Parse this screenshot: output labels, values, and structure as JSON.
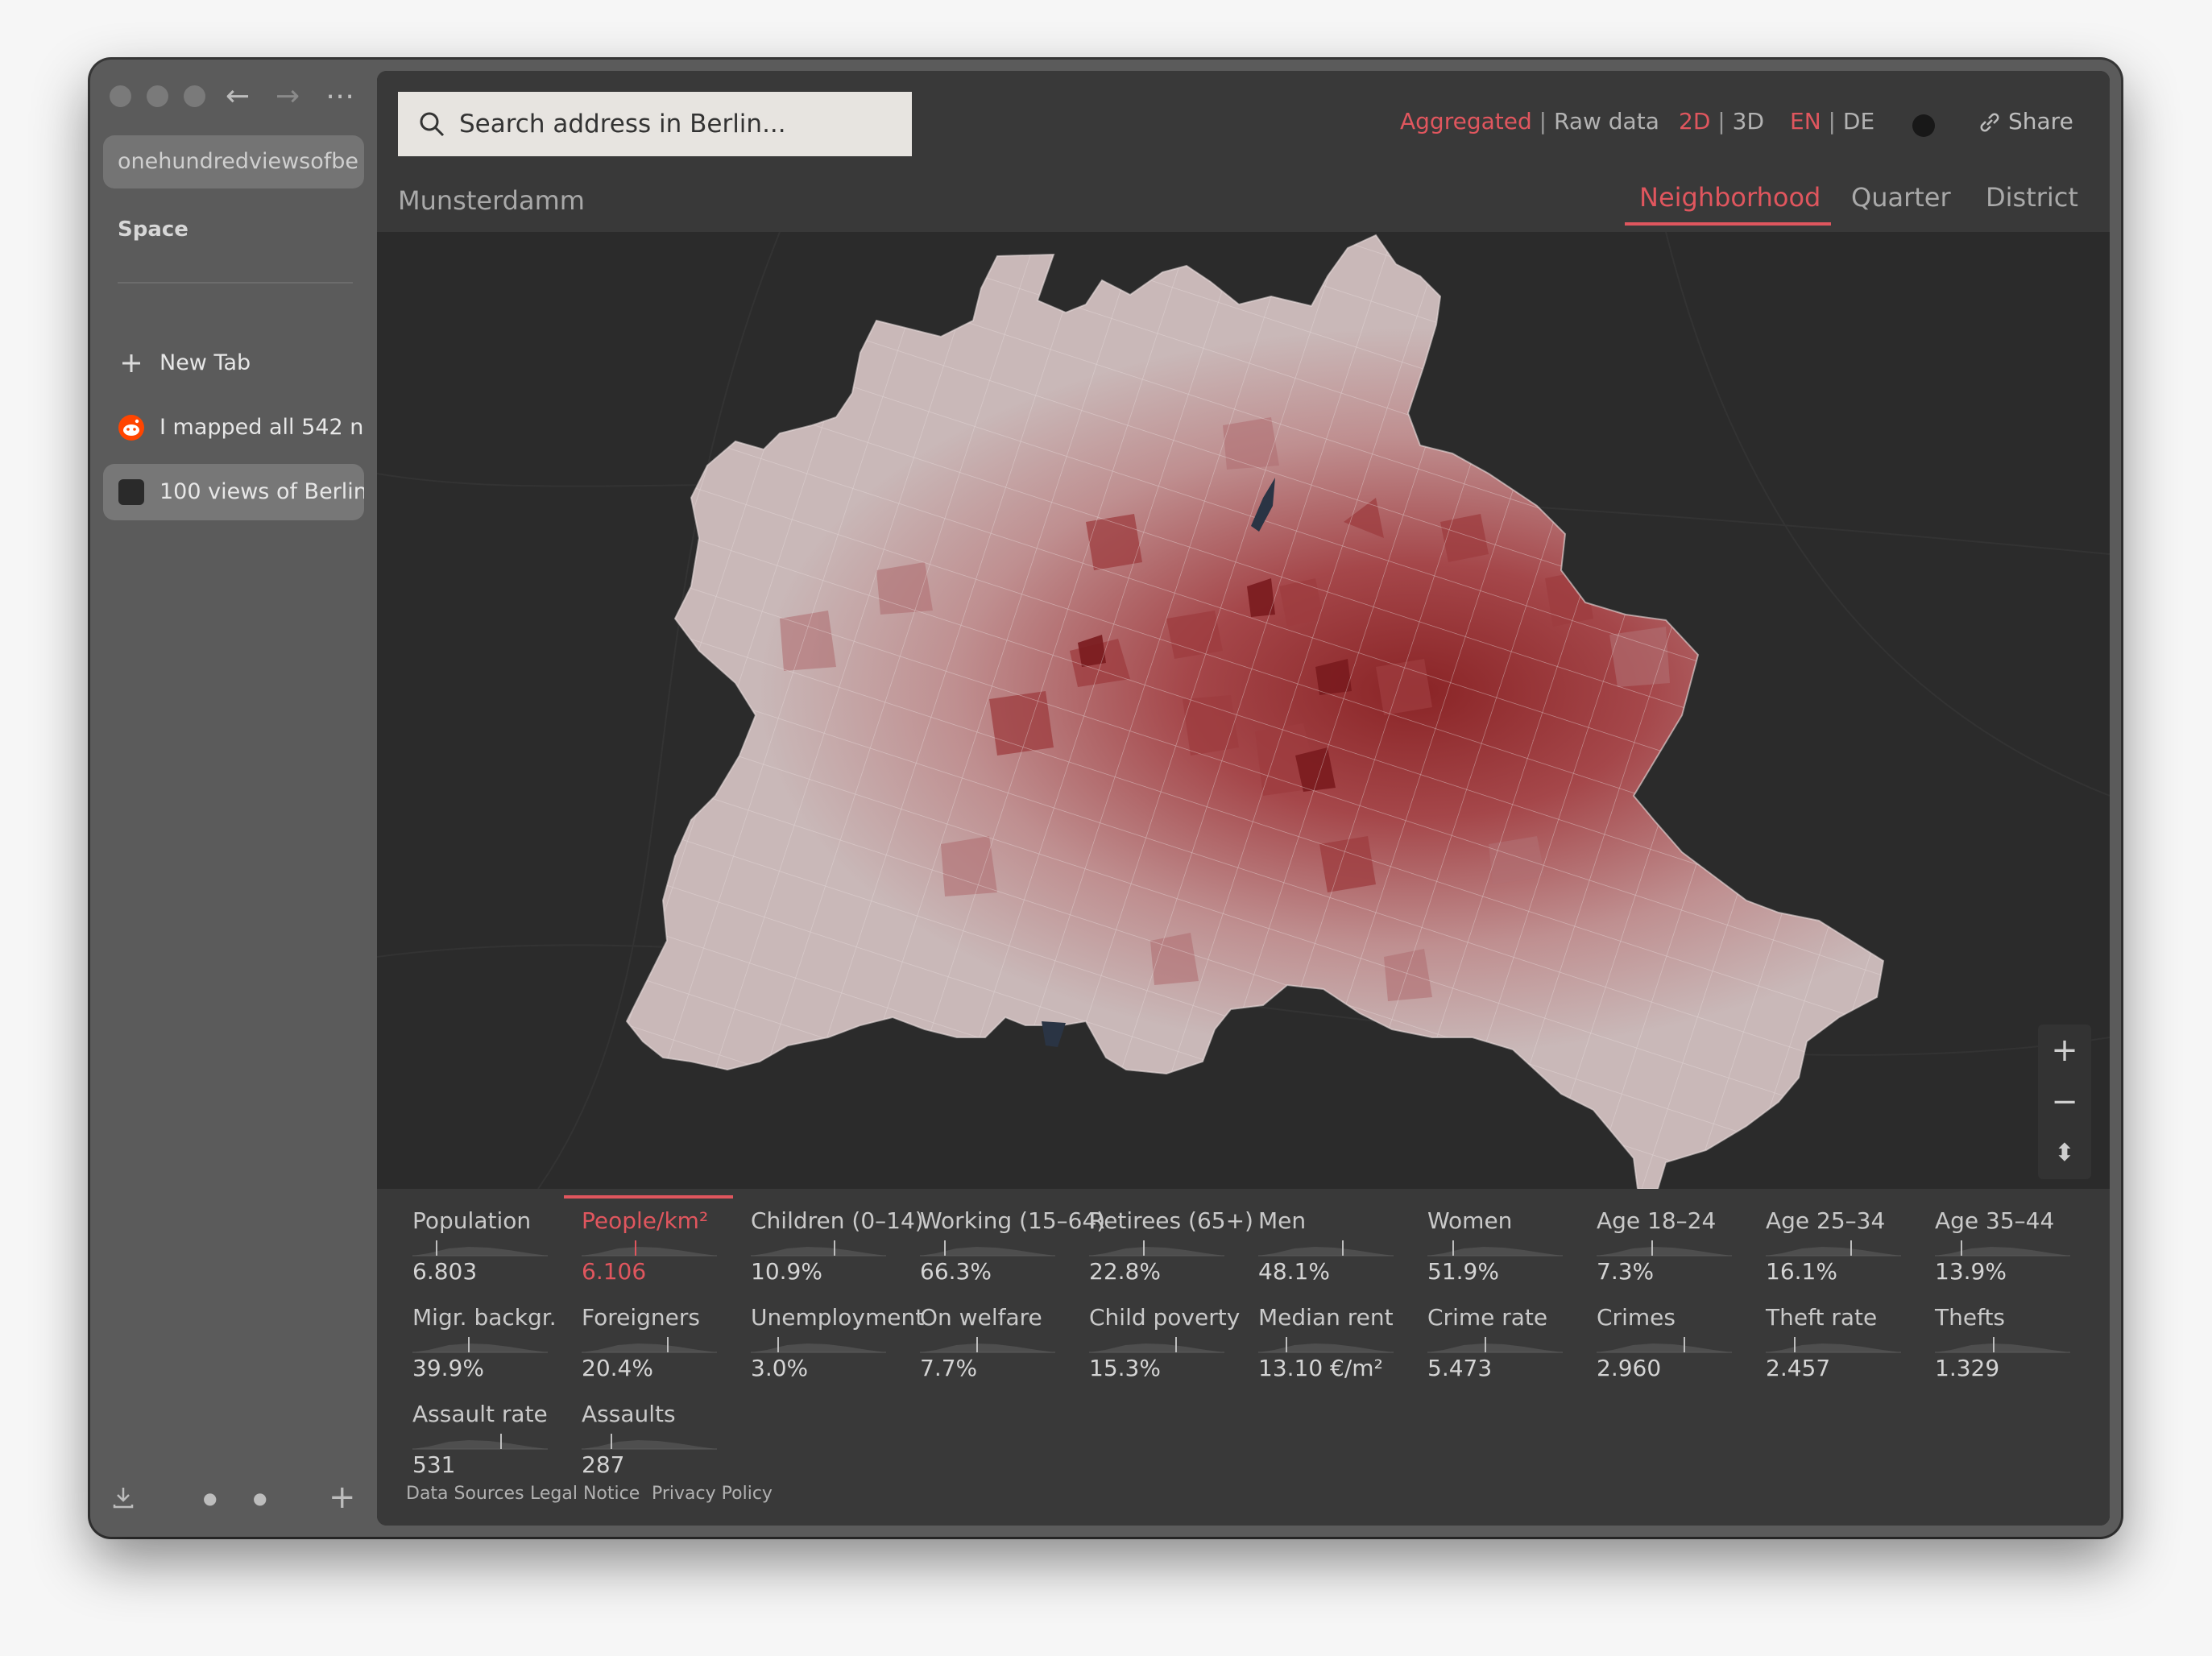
{
  "browser": {
    "url_text": "onehundredviewsofbe",
    "space_label": "Space",
    "tabs": [
      {
        "label": "New Tab"
      },
      {
        "label": "I mapped all 542 n"
      },
      {
        "label": "100 views of Berlin"
      }
    ]
  },
  "search": {
    "placeholder": "Search address in Berlin..."
  },
  "toggles": {
    "data_mode": {
      "active": "Aggregated",
      "inactive": "Raw data",
      "sep": "|"
    },
    "view_mode": {
      "active": "2D",
      "inactive": "3D",
      "sep": "|"
    },
    "language": {
      "active": "EN",
      "inactive": "DE",
      "sep": "|"
    },
    "share": "Share"
  },
  "location": "Munsterdamm",
  "levels": [
    {
      "label": "Neighborhood",
      "active": true
    },
    {
      "label": "Quarter",
      "active": false
    },
    {
      "label": "District",
      "active": false
    }
  ],
  "zoom": {
    "in": "+",
    "out": "−",
    "reset": "⬍"
  },
  "stats": [
    {
      "label": "Population",
      "value": "6.803",
      "active": false
    },
    {
      "label": "People/km²",
      "value": "6.106",
      "active": true
    },
    {
      "label": "Children (0–14)",
      "value": "10.9%",
      "active": false
    },
    {
      "label": "Working (15–64)",
      "value": "66.3%",
      "active": false
    },
    {
      "label": "Retirees (65+)",
      "value": "22.8%",
      "active": false
    },
    {
      "label": "Men",
      "value": "48.1%",
      "active": false
    },
    {
      "label": "Women",
      "value": "51.9%",
      "active": false
    },
    {
      "label": "Age 18–24",
      "value": "7.3%",
      "active": false
    },
    {
      "label": "Age 25–34",
      "value": "16.1%",
      "active": false
    },
    {
      "label": "Age 35–44",
      "value": "13.9%",
      "active": false
    },
    {
      "label": "Migr. backgr.",
      "value": "39.9%",
      "active": false
    },
    {
      "label": "Foreigners",
      "value": "20.4%",
      "active": false
    },
    {
      "label": "Unemployment",
      "value": "3.0%",
      "active": false
    },
    {
      "label": "On welfare",
      "value": "7.7%",
      "active": false
    },
    {
      "label": "Child poverty",
      "value": "15.3%",
      "active": false
    },
    {
      "label": "Median rent",
      "value": "13.10 €/m²",
      "active": false
    },
    {
      "label": "Crime rate",
      "value": "5.473",
      "active": false
    },
    {
      "label": "Crimes",
      "value": "2.960",
      "active": false
    },
    {
      "label": "Theft rate",
      "value": "2.457",
      "active": false
    },
    {
      "label": "Thefts",
      "value": "1.329",
      "active": false
    },
    {
      "label": "Assault rate",
      "value": "531",
      "active": false
    },
    {
      "label": "Assaults",
      "value": "287",
      "active": false
    }
  ],
  "footer": {
    "data_sources": "Data Sources",
    "legal": "Legal Notice",
    "privacy": "Privacy Policy"
  },
  "colors": {
    "accent": "#e0565e",
    "map_light": "#c9b8b8",
    "map_dark": "#8a2426",
    "map_bg": "#2b2b2b"
  }
}
